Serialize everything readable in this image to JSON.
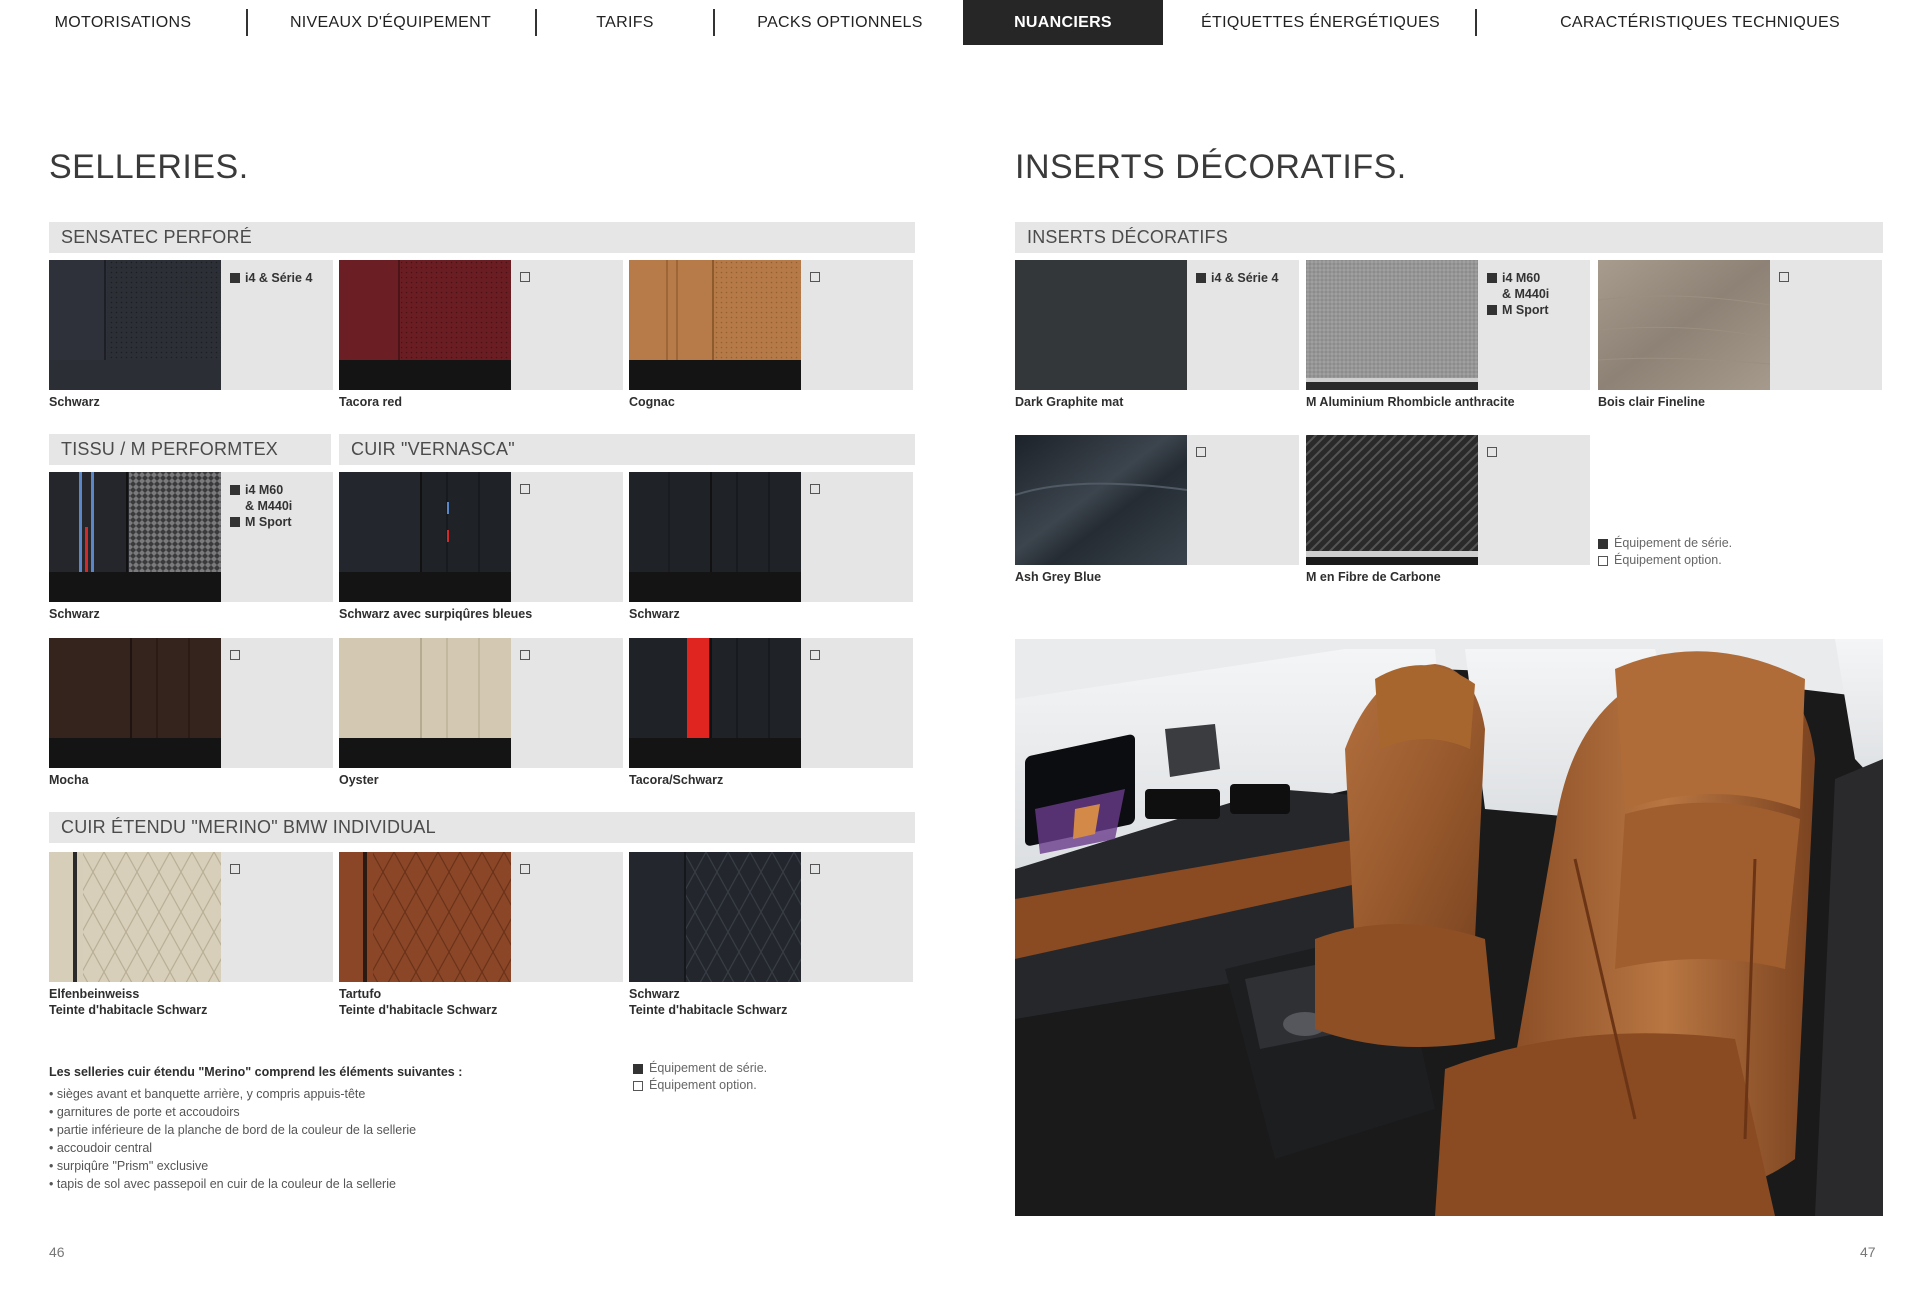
{
  "nav": {
    "items": [
      "MOTORISATIONS",
      "NIVEAUX D'ÉQUIPEMENT",
      "TARIFS",
      "PACKS OPTIONNELS",
      "NUANCIERS",
      "ÉTIQUETTES ÉNERGÉTIQUES",
      "CARACTÉRISTIQUES TECHNIQUES"
    ],
    "active": "NUANCIERS"
  },
  "left": {
    "title": "SELLERIES.",
    "sections": {
      "sensatec": "SENSATEC PERFORÉ",
      "tissu": "TISSU / M PERFORMTEX",
      "cuir": "CUIR \"VERNASCA\"",
      "merino": "CUIR ÉTENDU \"MERINO\" BMW INDIVIDUAL"
    },
    "cells": {
      "s1": {
        "caption": "Schwarz",
        "tag": [
          "i4 & Série 4"
        ]
      },
      "s2": {
        "caption": "Tacora red"
      },
      "s3": {
        "caption": "Cognac"
      },
      "t1": {
        "caption": "Schwarz",
        "tag": [
          "i4 M60",
          "& M440i",
          "M Sport"
        ]
      },
      "c1": {
        "caption": "Schwarz avec surpiqûres bleues"
      },
      "c2": {
        "caption": "Schwarz"
      },
      "c3": {
        "caption": "Mocha"
      },
      "c4": {
        "caption": "Oyster"
      },
      "c5": {
        "caption": "Tacora/Schwarz"
      },
      "m1": {
        "caption": "Elfenbeinweiss",
        "caption2": "Teinte d'habitacle Schwarz"
      },
      "m2": {
        "caption": "Tartufo",
        "caption2": "Teinte d'habitacle Schwarz"
      },
      "m3": {
        "caption": "Schwarz",
        "caption2": "Teinte d'habitacle Schwarz"
      }
    },
    "notes": {
      "heading": "Les selleries cuir étendu \"Merino\" comprend les éléments suivantes :",
      "items": [
        "sièges avant et banquette arrière, y compris appuis-tête",
        "garnitures de porte et accoudoirs",
        "partie inférieure de la planche de bord de la couleur de la sellerie",
        "accoudoir central",
        "surpiqûre \"Prism\" exclusive",
        "tapis de sol avec passepoil en cuir de la couleur de la sellerie"
      ]
    },
    "legend": {
      "standard": "Équipement de série.",
      "option": "Équipement option."
    },
    "page_number": "46"
  },
  "right": {
    "title": "INSERTS DÉCORATIFS.",
    "section": "INSERTS DÉCORATIFS",
    "cells": {
      "i1": {
        "caption": "Dark Graphite mat",
        "tag": [
          "i4 & Série 4"
        ]
      },
      "i2": {
        "caption": "M Aluminium Rhombicle anthracite",
        "tag": [
          "i4 M60",
          "& M440i",
          "M Sport"
        ]
      },
      "i3": {
        "caption": "Bois clair Fineline"
      },
      "i4": {
        "caption": "Ash Grey Blue"
      },
      "i5": {
        "caption": "M en Fibre de Carbone"
      }
    },
    "legend": {
      "standard": "Équipement de série.",
      "option": "Équipement option."
    },
    "page_number": "47"
  },
  "colors": {
    "nav_active_bg": "#262626",
    "bar_bg": "#e6e6e6",
    "cell_bg": "#e5e5e6",
    "cognac": "#b67a48",
    "tacora_red": "#6b1e22",
    "tacora_accent": "#e0241f"
  }
}
